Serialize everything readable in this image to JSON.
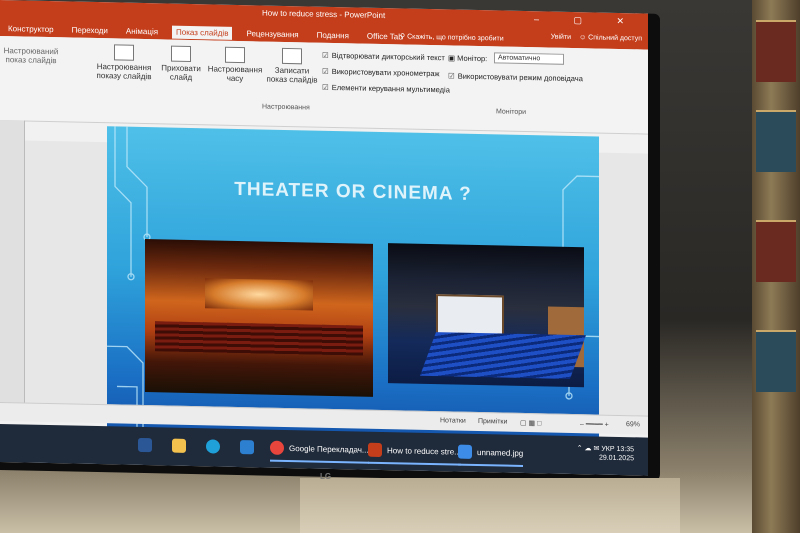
{
  "window": {
    "title": "How to reduce stress - PowerPoint",
    "controls": "– ▢ ✕"
  },
  "ribbon": {
    "tabs": [
      "Конструктор",
      "Переходи",
      "Анімація",
      "Показ слайдів",
      "Рецензування",
      "Подання",
      "Office Tab"
    ],
    "active_tab": "Показ слайдів",
    "tell_me": "Скажіть, що потрібно зробити",
    "user": {
      "sign_in": "Увійти",
      "share": "Спільний доступ"
    },
    "buttons": [
      {
        "label": "Настроювання показу слайдів"
      },
      {
        "label": "Приховати слайд"
      },
      {
        "label": "Настроювання часу"
      },
      {
        "label": "Записати показ слайдів"
      }
    ],
    "left_fragments": [
      "Настроюваний",
      "показ слайдів"
    ],
    "checkboxes": [
      "Відтворювати дикторський текст",
      "Використовувати хронометраж",
      "Елементи керування мультимедіа"
    ],
    "group_setup_label": "Настроювання",
    "monitor_label": "Монітор:",
    "monitor_value": "Автоматично",
    "presenter_view": "Використовувати режим доповідача",
    "group_monitors_label": "Монітори"
  },
  "slide": {
    "title": "THEATER OR CINEMA ?"
  },
  "statusbar": {
    "notes": "Нотатки",
    "comments": "Примітки",
    "zoom": "69%"
  },
  "taskbar": {
    "apps": [
      {
        "name": "word-icon",
        "color": "#2b5797"
      },
      {
        "name": "explorer-icon",
        "color": "#f2c14e"
      },
      {
        "name": "edge-icon",
        "color": "#1fa0d8"
      },
      {
        "name": "calculator-icon",
        "color": "#2d7fd0"
      }
    ],
    "windows": [
      {
        "label": "Google Перекладач...",
        "color": "#e8453c"
      },
      {
        "label": "How to reduce stre...",
        "color": "#c43e1c"
      },
      {
        "label": "unnamed.jpg",
        "color": "#3c8ce8"
      }
    ],
    "language": "УКР",
    "time": "13:35",
    "date": "29.01.2025"
  },
  "tv_brand": "LG"
}
